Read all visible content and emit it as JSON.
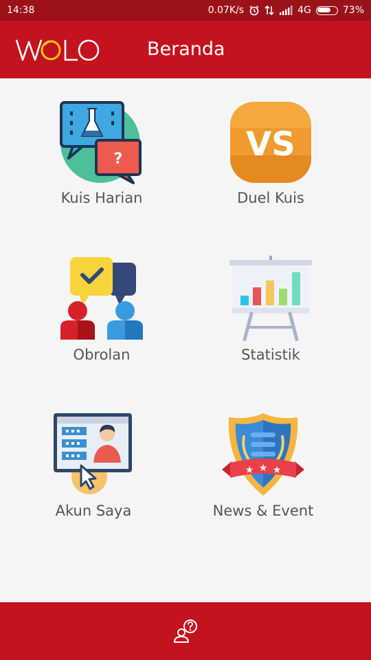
{
  "status_bar": {
    "time": "14:38",
    "net_speed": "0.07K/s",
    "network": "4G",
    "battery": "73%",
    "battery_level": 0.73,
    "icons": [
      "alarm-icon",
      "data-transfer-icon",
      "signal-icon",
      "battery-icon"
    ]
  },
  "app_bar": {
    "logo_text": "WOLO",
    "title": "Beranda"
  },
  "menu": {
    "items": [
      {
        "label": "Kuis Harian",
        "icon": "daily-quiz-icon"
      },
      {
        "label": "Duel Kuis",
        "icon": "versus-icon"
      },
      {
        "label": "Obrolan",
        "icon": "chat-icon"
      },
      {
        "label": "Statistik",
        "icon": "statistics-icon"
      },
      {
        "label": "Akun Saya",
        "icon": "account-icon"
      },
      {
        "label": "News & Event",
        "icon": "news-event-icon"
      }
    ]
  },
  "bottom_bar": {
    "icon": "help-user-icon"
  },
  "colors": {
    "status_bar": "#9b1219",
    "primary": "#c4131e",
    "background": "#f5f5f5",
    "label_text": "#555555"
  }
}
